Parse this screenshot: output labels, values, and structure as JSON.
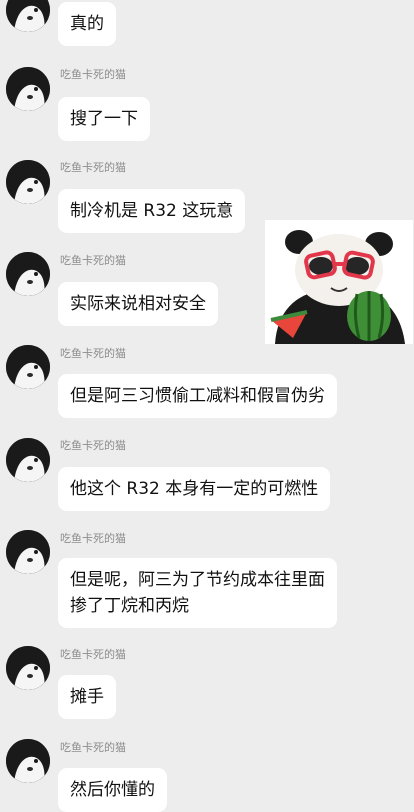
{
  "chat": {
    "sender_name": "吃鱼卡死的猫",
    "messages": [
      {
        "text": "真的"
      },
      {
        "text": "搜了一下"
      },
      {
        "text": "制冷机是 R32 这玩意"
      },
      {
        "text": "实际来说相对安全"
      },
      {
        "text": "但是阿三习惯偷工减料和假冒伪劣"
      },
      {
        "text": "他这个 R32 本身有一定的可燃性"
      },
      {
        "lines": [
          "但是呢，阿三为了节约成本往里面",
          "掺了丁烷和丙烷"
        ]
      },
      {
        "text": "摊手"
      },
      {
        "text": "然后你懂的"
      }
    ]
  },
  "sticker": {
    "icon": "panda-with-watermelon-sticker"
  }
}
